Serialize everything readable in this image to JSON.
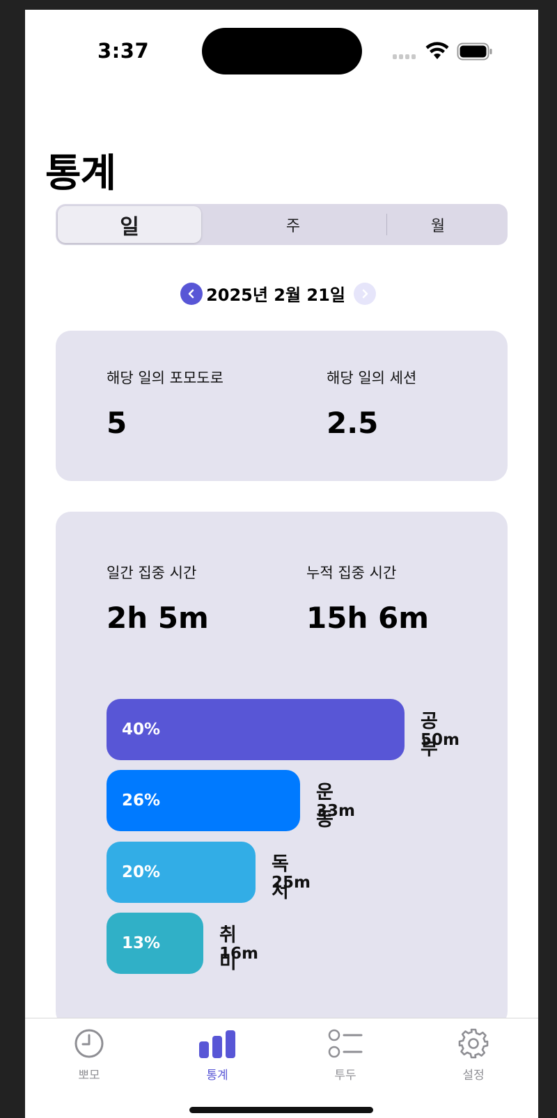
{
  "status_bar": {
    "time": "3:37"
  },
  "header": {
    "title": "통계"
  },
  "segmented": {
    "options": [
      "일",
      "주",
      "월"
    ],
    "selected": "일"
  },
  "date_nav": {
    "date": "2025년 2월 21일",
    "prev_icon": "chevron-left-icon",
    "next_icon": "chevron-right-icon"
  },
  "summary": {
    "pomodoro_label": "해당 일의 포모도로",
    "pomodoro_value": "5",
    "session_label": "해당 일의 세션",
    "session_value": "2.5"
  },
  "focus": {
    "daily_label": "일간 집중 시간",
    "daily_value": "2h 5m",
    "total_label": "누적 집중 시간",
    "total_value": "15h 6m"
  },
  "categories": [
    {
      "percent_label": "40%",
      "percent": 40,
      "name": "공부",
      "duration": "50m",
      "color": "#5856d6"
    },
    {
      "percent_label": "26%",
      "percent": 26,
      "name": "운동",
      "duration": "33m",
      "color": "#007aff"
    },
    {
      "percent_label": "20%",
      "percent": 20,
      "name": "독서",
      "duration": "25m",
      "color": "#32ade6"
    },
    {
      "percent_label": "13%",
      "percent": 13,
      "name": "취미",
      "duration": "16m",
      "color": "#30b0c7"
    }
  ],
  "tabs": [
    {
      "label": "뽀모",
      "icon": "clock-icon",
      "active": false
    },
    {
      "label": "통계",
      "icon": "bar-chart-icon",
      "active": true
    },
    {
      "label": "투두",
      "icon": "list-icon",
      "active": false
    },
    {
      "label": "설정",
      "icon": "gear-icon",
      "active": false
    }
  ],
  "colors": {
    "accent": "#5856d6",
    "card_bg": "#e4e3ef",
    "inactive": "#8e8e93"
  }
}
